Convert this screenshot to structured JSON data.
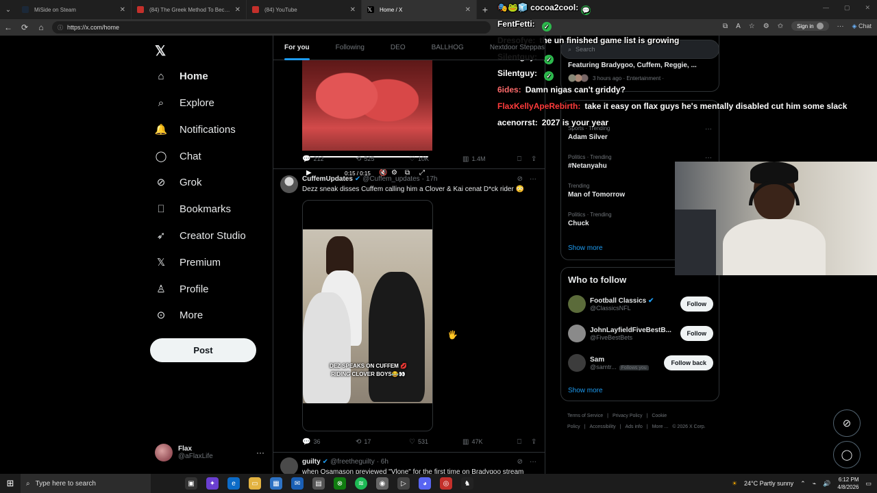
{
  "browser": {
    "tabs": [
      {
        "title": "MiSide on Steam",
        "color": "#1b2838",
        "active": false
      },
      {
        "title": "(84) The Greek Method To Become",
        "color": "#c4302b",
        "active": false
      },
      {
        "title": "(84) YouTube",
        "color": "#c4302b",
        "active": false
      },
      {
        "title": "Home / X",
        "color": "#000000",
        "active": true
      }
    ],
    "url": "https://x.com/home",
    "sign_in": "Sign in",
    "chat_label": "Chat"
  },
  "nav": {
    "items": [
      {
        "label": "Home",
        "icon": "home-icon",
        "glyph": "⌂"
      },
      {
        "label": "Explore",
        "icon": "search-icon",
        "glyph": "⌕"
      },
      {
        "label": "Notifications",
        "icon": "bell-icon",
        "glyph": "🔔"
      },
      {
        "label": "Chat",
        "icon": "chat-icon",
        "glyph": "◯"
      },
      {
        "label": "Grok",
        "icon": "grok-icon",
        "glyph": "⊘"
      },
      {
        "label": "Bookmarks",
        "icon": "bookmark-icon",
        "glyph": "⎕"
      },
      {
        "label": "Creator Studio",
        "icon": "rocket-icon",
        "glyph": "➶"
      },
      {
        "label": "Premium",
        "icon": "x-logo-icon",
        "glyph": "𝕏"
      },
      {
        "label": "Profile",
        "icon": "person-icon",
        "glyph": "♙"
      },
      {
        "label": "More",
        "icon": "more-circle-icon",
        "glyph": "⊙"
      }
    ],
    "post_label": "Post",
    "account": {
      "name": "Flax",
      "handle": "@aFlaxLife"
    }
  },
  "feed": {
    "tabs": [
      "For you",
      "Following",
      "DEO",
      "BALLHOG",
      "Nextdoor Steppas"
    ],
    "tweet1": {
      "time": "0:15 / 0:15",
      "progress": 1.0,
      "replies": "212",
      "reposts": "525",
      "likes": "10K",
      "views": "1.4M"
    },
    "tweet2": {
      "name": "CuffemUpdates",
      "handle": "@Cuffem_updates",
      "age": "· 17h",
      "text": "Dezz sneak disses Cuffem calling him a Clover & Kai cenat D*ck rider 😳",
      "caption_line1": "DEZ SPEAKS ON CUFFEM 💋",
      "caption_line2": "RIDING CLOVER BOYS😂👀",
      "replies": "36",
      "reposts": "17",
      "likes": "531",
      "views": "47K"
    },
    "tweet3": {
      "name": "guilty",
      "handle": "@freetheguilty",
      "age": "· 6h",
      "text": "when Osamason previewed \"Vlone\" for the first time on Bradygoo stream"
    }
  },
  "sidebar": {
    "search_placeholder": "Search",
    "news": {
      "title": "Featuring Bradygoo, Cuffem, Reggie, ...",
      "meta": "3 hours ago · Entertainment ·"
    },
    "trends": [
      {
        "category": "Sports · Trending",
        "title": "Adam Silver"
      },
      {
        "category": "Politics · Trending",
        "title": "#Netanyahu"
      },
      {
        "category": "Trending",
        "title": "Man of Tomorrow"
      },
      {
        "category": "Politics · Trending",
        "title": "Chuck"
      }
    ],
    "show_more": "Show more",
    "who_to_follow": "Who to follow",
    "suggestions": [
      {
        "name": "Football Classics",
        "handle": "@ClassicsNFL",
        "button": "Follow",
        "verified": true,
        "follows_you": ""
      },
      {
        "name": "JohnLayfieldFiveBestB...",
        "handle": "@FiveBestBets",
        "button": "Follow",
        "verified": false,
        "follows_you": ""
      },
      {
        "name": "Sam",
        "handle": "@samtr...",
        "button": "Follow back",
        "verified": false,
        "follows_you": "Follows you"
      }
    ],
    "show_more_2": "Show more",
    "footer": [
      "Terms of Service",
      "|",
      "Privacy Policy",
      "|",
      "Cookie Policy",
      "|",
      "Accessibility",
      "|",
      "Ads info",
      "|",
      "More ...",
      "© 2026 X Corp."
    ]
  },
  "stream_chat": [
    {
      "user": "",
      "user_color": "#ffffff",
      "message": "cocoa2cool:",
      "badge": "💬"
    },
    {
      "user": "FentFetti:",
      "user_color": "#ffffff",
      "message": "",
      "badge": "✓"
    },
    {
      "user": "Dresofye:",
      "user_color": "#ffffff",
      "message": "the un finished game list is growing",
      "badge": ""
    },
    {
      "user": "Silentguy:",
      "user_color": "#ffffff",
      "message": "",
      "badge": "✓"
    },
    {
      "user": "Silentguy:",
      "user_color": "#ffffff",
      "message": "",
      "badge": "✓"
    },
    {
      "user": "6ides:",
      "user_color": "#ff6b6b",
      "message": "Damn nigas can't griddy?",
      "badge": ""
    },
    {
      "user": "FlaxKellyApeRebirth:",
      "user_color": "#ff3b3b",
      "message": "take it easy on flax guys he's mentally disabled cut him some slack",
      "badge": ""
    },
    {
      "user": "acenorrst:",
      "user_color": "#ffffff",
      "message": "2027 is your year",
      "badge": ""
    }
  ],
  "taskbar": {
    "search_placeholder": "Type here to search",
    "weather": "24°C  Partly sunny",
    "time": "6:12 PM",
    "date": "4/8/2026"
  }
}
